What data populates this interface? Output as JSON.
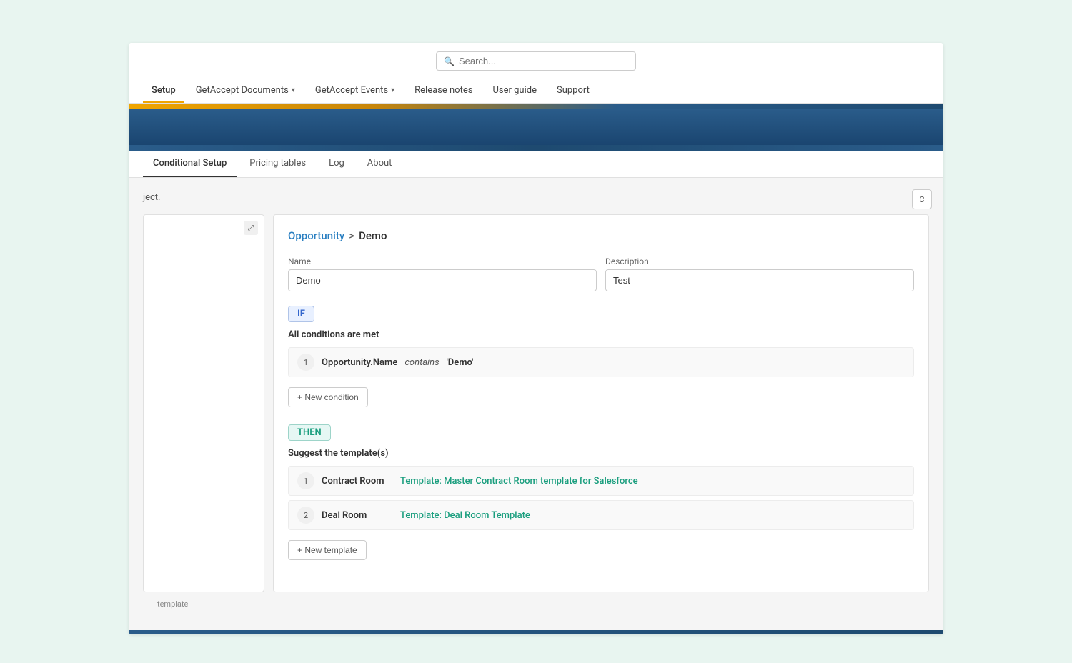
{
  "search": {
    "placeholder": "Search..."
  },
  "topnav": {
    "items": [
      {
        "label": "Setup",
        "active": true,
        "hasDropdown": false
      },
      {
        "label": "GetAccept Documents",
        "active": false,
        "hasDropdown": true
      },
      {
        "label": "GetAccept Events",
        "active": false,
        "hasDropdown": true
      },
      {
        "label": "Release notes",
        "active": false,
        "hasDropdown": false
      },
      {
        "label": "User guide",
        "active": false,
        "hasDropdown": false
      },
      {
        "label": "Support",
        "active": false,
        "hasDropdown": false
      }
    ]
  },
  "subnav": {
    "items": [
      {
        "label": "Conditional Setup",
        "active": true
      },
      {
        "label": "Pricing tables",
        "active": false
      },
      {
        "label": "Log",
        "active": false
      },
      {
        "label": "About",
        "active": false
      }
    ]
  },
  "topright_btn": "C",
  "body_text": "ject.",
  "breadcrumb": {
    "opportunity": "Opportunity",
    "separator": ">",
    "current": "Demo"
  },
  "form": {
    "name_label": "Name",
    "name_value": "Demo",
    "description_label": "Description",
    "description_value": "Test"
  },
  "if_section": {
    "tag": "IF",
    "subtitle": "All conditions are met",
    "conditions": [
      {
        "number": "1",
        "field": "Opportunity.Name",
        "operator": "contains",
        "value": "'Demo'"
      }
    ],
    "add_condition_label": "+ New condition"
  },
  "then_section": {
    "tag": "THEN",
    "subtitle": "Suggest the template(s)",
    "templates": [
      {
        "number": "1",
        "type": "Contract Room",
        "link": "Template: Master Contract Room template for Salesforce"
      },
      {
        "number": "2",
        "type": "Deal Room",
        "link": "Template: Deal Room Template"
      }
    ],
    "add_template_label": "+ New template"
  },
  "footer_text": "template"
}
